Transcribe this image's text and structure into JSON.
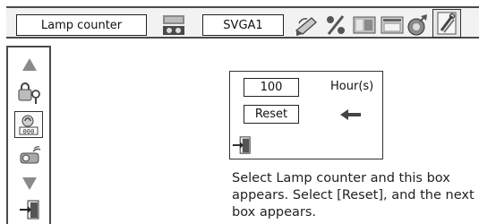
{
  "menu_bar": {
    "title": "Lamp counter",
    "mode": "SVGA1",
    "icons": [
      "input-select-icon",
      "pc-adjust-icon",
      "percent-icon",
      "image-select-icon",
      "screen-icon",
      "settings-icon",
      "tools-icon"
    ]
  },
  "side_panel": {
    "items": [
      "up-arrow-icon",
      "security-key-icon",
      "lamp-counter-icon",
      "remote-projector-icon",
      "down-arrow-icon",
      "exit-icon"
    ]
  },
  "dialog": {
    "hours_value": "100",
    "hours_unit": "Hour(s)",
    "reset_label": "Reset",
    "pointer_icon": "arrow-left-icon",
    "exit_icon": "exit-icon"
  },
  "instruction_text": "Select Lamp counter and this box appears. Select [Reset], and the next box appears."
}
